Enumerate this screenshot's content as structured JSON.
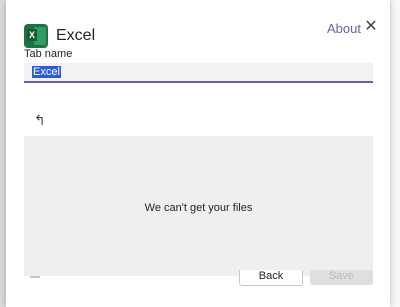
{
  "app": {
    "title": "Excel",
    "icon": "excel-icon",
    "icon_letter": "X"
  },
  "header": {
    "about_label": "About",
    "close_icon": "close-icon",
    "close_glyph": "✕"
  },
  "tab_name": {
    "label": "Tab name",
    "value": "Excel"
  },
  "navigation": {
    "up_icon": "up-arrow-icon",
    "up_glyph": "↰"
  },
  "files": {
    "message": "We can't get your files"
  },
  "footer": {
    "back_label": "Back",
    "save_label": "Save"
  },
  "colors": {
    "accent": "#6264a7",
    "excel_green": "#1e7145",
    "selection": "#2b5cd4"
  }
}
